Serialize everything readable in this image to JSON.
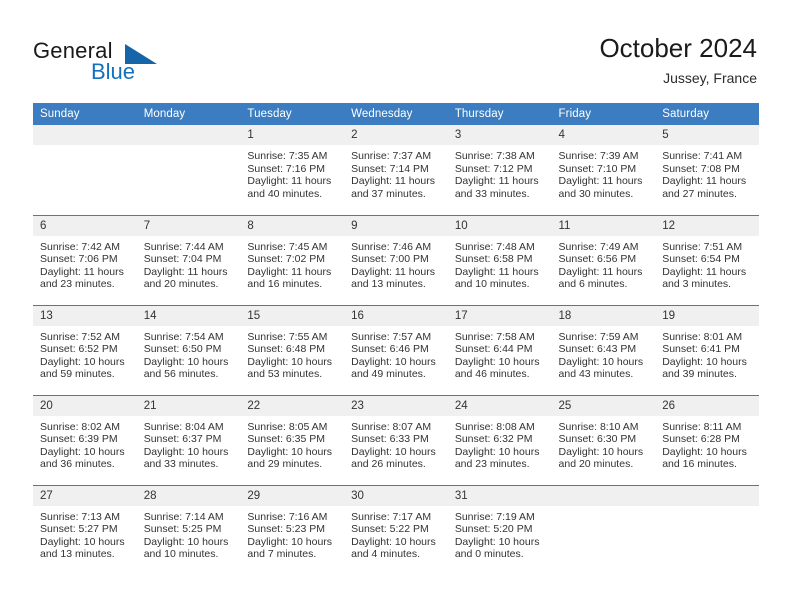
{
  "brand": {
    "word_one": "General",
    "word_two": "Blue",
    "triangle_color": "#1565a8",
    "blue_color": "#1471bd"
  },
  "header": {
    "title": "October 2024",
    "subtitle": "Jussey, France"
  },
  "theme": {
    "header_blue": "#3b7dc0",
    "daynum_band": "#f0f0f0",
    "text": "#333333"
  },
  "calendar": {
    "weekday_headers": [
      "Sunday",
      "Monday",
      "Tuesday",
      "Wednesday",
      "Thursday",
      "Friday",
      "Saturday"
    ],
    "weeks": [
      [
        {
          "day": "",
          "blank": true
        },
        {
          "day": "",
          "blank": true
        },
        {
          "day": "1",
          "sunrise": "Sunrise: 7:35 AM",
          "sunset": "Sunset: 7:16 PM",
          "daylight": "Daylight: 11 hours and 40 minutes."
        },
        {
          "day": "2",
          "sunrise": "Sunrise: 7:37 AM",
          "sunset": "Sunset: 7:14 PM",
          "daylight": "Daylight: 11 hours and 37 minutes."
        },
        {
          "day": "3",
          "sunrise": "Sunrise: 7:38 AM",
          "sunset": "Sunset: 7:12 PM",
          "daylight": "Daylight: 11 hours and 33 minutes."
        },
        {
          "day": "4",
          "sunrise": "Sunrise: 7:39 AM",
          "sunset": "Sunset: 7:10 PM",
          "daylight": "Daylight: 11 hours and 30 minutes."
        },
        {
          "day": "5",
          "sunrise": "Sunrise: 7:41 AM",
          "sunset": "Sunset: 7:08 PM",
          "daylight": "Daylight: 11 hours and 27 minutes."
        }
      ],
      [
        {
          "day": "6",
          "sunrise": "Sunrise: 7:42 AM",
          "sunset": "Sunset: 7:06 PM",
          "daylight": "Daylight: 11 hours and 23 minutes."
        },
        {
          "day": "7",
          "sunrise": "Sunrise: 7:44 AM",
          "sunset": "Sunset: 7:04 PM",
          "daylight": "Daylight: 11 hours and 20 minutes."
        },
        {
          "day": "8",
          "sunrise": "Sunrise: 7:45 AM",
          "sunset": "Sunset: 7:02 PM",
          "daylight": "Daylight: 11 hours and 16 minutes."
        },
        {
          "day": "9",
          "sunrise": "Sunrise: 7:46 AM",
          "sunset": "Sunset: 7:00 PM",
          "daylight": "Daylight: 11 hours and 13 minutes."
        },
        {
          "day": "10",
          "sunrise": "Sunrise: 7:48 AM",
          "sunset": "Sunset: 6:58 PM",
          "daylight": "Daylight: 11 hours and 10 minutes."
        },
        {
          "day": "11",
          "sunrise": "Sunrise: 7:49 AM",
          "sunset": "Sunset: 6:56 PM",
          "daylight": "Daylight: 11 hours and 6 minutes."
        },
        {
          "day": "12",
          "sunrise": "Sunrise: 7:51 AM",
          "sunset": "Sunset: 6:54 PM",
          "daylight": "Daylight: 11 hours and 3 minutes."
        }
      ],
      [
        {
          "day": "13",
          "sunrise": "Sunrise: 7:52 AM",
          "sunset": "Sunset: 6:52 PM",
          "daylight": "Daylight: 10 hours and 59 minutes."
        },
        {
          "day": "14",
          "sunrise": "Sunrise: 7:54 AM",
          "sunset": "Sunset: 6:50 PM",
          "daylight": "Daylight: 10 hours and 56 minutes."
        },
        {
          "day": "15",
          "sunrise": "Sunrise: 7:55 AM",
          "sunset": "Sunset: 6:48 PM",
          "daylight": "Daylight: 10 hours and 53 minutes."
        },
        {
          "day": "16",
          "sunrise": "Sunrise: 7:57 AM",
          "sunset": "Sunset: 6:46 PM",
          "daylight": "Daylight: 10 hours and 49 minutes."
        },
        {
          "day": "17",
          "sunrise": "Sunrise: 7:58 AM",
          "sunset": "Sunset: 6:44 PM",
          "daylight": "Daylight: 10 hours and 46 minutes."
        },
        {
          "day": "18",
          "sunrise": "Sunrise: 7:59 AM",
          "sunset": "Sunset: 6:43 PM",
          "daylight": "Daylight: 10 hours and 43 minutes."
        },
        {
          "day": "19",
          "sunrise": "Sunrise: 8:01 AM",
          "sunset": "Sunset: 6:41 PM",
          "daylight": "Daylight: 10 hours and 39 minutes."
        }
      ],
      [
        {
          "day": "20",
          "sunrise": "Sunrise: 8:02 AM",
          "sunset": "Sunset: 6:39 PM",
          "daylight": "Daylight: 10 hours and 36 minutes."
        },
        {
          "day": "21",
          "sunrise": "Sunrise: 8:04 AM",
          "sunset": "Sunset: 6:37 PM",
          "daylight": "Daylight: 10 hours and 33 minutes."
        },
        {
          "day": "22",
          "sunrise": "Sunrise: 8:05 AM",
          "sunset": "Sunset: 6:35 PM",
          "daylight": "Daylight: 10 hours and 29 minutes."
        },
        {
          "day": "23",
          "sunrise": "Sunrise: 8:07 AM",
          "sunset": "Sunset: 6:33 PM",
          "daylight": "Daylight: 10 hours and 26 minutes."
        },
        {
          "day": "24",
          "sunrise": "Sunrise: 8:08 AM",
          "sunset": "Sunset: 6:32 PM",
          "daylight": "Daylight: 10 hours and 23 minutes."
        },
        {
          "day": "25",
          "sunrise": "Sunrise: 8:10 AM",
          "sunset": "Sunset: 6:30 PM",
          "daylight": "Daylight: 10 hours and 20 minutes."
        },
        {
          "day": "26",
          "sunrise": "Sunrise: 8:11 AM",
          "sunset": "Sunset: 6:28 PM",
          "daylight": "Daylight: 10 hours and 16 minutes."
        }
      ],
      [
        {
          "day": "27",
          "sunrise": "Sunrise: 7:13 AM",
          "sunset": "Sunset: 5:27 PM",
          "daylight": "Daylight: 10 hours and 13 minutes."
        },
        {
          "day": "28",
          "sunrise": "Sunrise: 7:14 AM",
          "sunset": "Sunset: 5:25 PM",
          "daylight": "Daylight: 10 hours and 10 minutes."
        },
        {
          "day": "29",
          "sunrise": "Sunrise: 7:16 AM",
          "sunset": "Sunset: 5:23 PM",
          "daylight": "Daylight: 10 hours and 7 minutes."
        },
        {
          "day": "30",
          "sunrise": "Sunrise: 7:17 AM",
          "sunset": "Sunset: 5:22 PM",
          "daylight": "Daylight: 10 hours and 4 minutes."
        },
        {
          "day": "31",
          "sunrise": "Sunrise: 7:19 AM",
          "sunset": "Sunset: 5:20 PM",
          "daylight": "Daylight: 10 hours and 0 minutes."
        },
        {
          "day": "",
          "blank": true
        },
        {
          "day": "",
          "blank": true
        }
      ]
    ]
  }
}
